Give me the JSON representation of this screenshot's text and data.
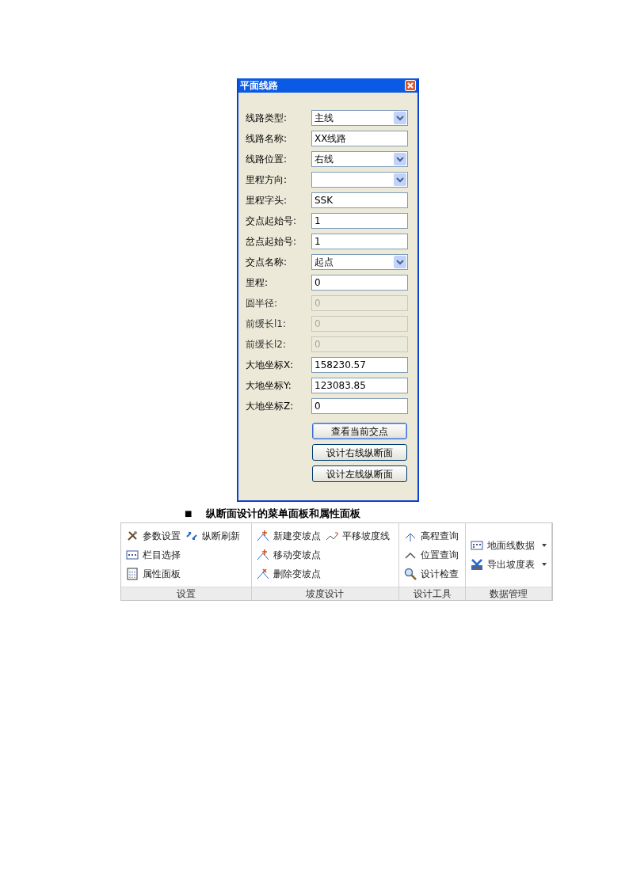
{
  "dialog": {
    "title": "平面线路",
    "fields": [
      {
        "label": "线路类型:",
        "kind": "select",
        "value": "主线",
        "disabled": false
      },
      {
        "label": "线路名称:",
        "kind": "text",
        "value": "XX线路",
        "disabled": false
      },
      {
        "label": "线路位置:",
        "kind": "select",
        "value": "右线",
        "disabled": false
      },
      {
        "label": "里程方向:",
        "kind": "select",
        "disabled": false
      },
      {
        "label": "里程字头:",
        "kind": "text",
        "value": "SSK",
        "disabled": false
      },
      {
        "label": "交点起始号:",
        "kind": "text",
        "value": "1",
        "disabled": false
      },
      {
        "label": "岔点起始号:",
        "kind": "text",
        "value": "1",
        "disabled": false
      },
      {
        "label": "交点名称:",
        "kind": "select",
        "value": "起点",
        "disabled": false
      },
      {
        "label": "里程:",
        "kind": "text",
        "value": "0",
        "disabled": false
      },
      {
        "label": "圆半径:",
        "kind": "text",
        "value": "0",
        "disabled": true
      },
      {
        "label": "前缓长l1:",
        "kind": "text",
        "value": "0",
        "disabled": true
      },
      {
        "label": "前缓长l2:",
        "kind": "text",
        "value": "0",
        "disabled": true
      },
      {
        "label": "大地坐标X:",
        "kind": "text",
        "value": "158230.57",
        "disabled": false
      },
      {
        "label": "大地坐标Y:",
        "kind": "text",
        "value": "123083.85",
        "disabled": false
      },
      {
        "label": "大地坐标Z:",
        "kind": "text",
        "value": "0",
        "disabled": false
      }
    ],
    "buttons": [
      {
        "label": "查看当前交点",
        "focused": true
      },
      {
        "label": "设计右线纵断面",
        "focused": false
      },
      {
        "label": "设计左线纵断面",
        "focused": false
      }
    ]
  },
  "caption": {
    "bullet": "■",
    "text": "纵断面设计的菜单面板和属性面板"
  },
  "ribbon": {
    "groups": [
      {
        "label": "设置",
        "columns": [
          [
            {
              "label": "参数设置"
            },
            {
              "label": "栏目选择"
            },
            {
              "label": "属性面板"
            }
          ],
          [
            {
              "label": "纵断刷新"
            }
          ]
        ]
      },
      {
        "label": "坡度设计",
        "columns": [
          [
            {
              "label": "新建变坡点"
            },
            {
              "label": "移动变坡点"
            },
            {
              "label": "删除变坡点"
            }
          ],
          [
            {
              "label": "平移坡度线"
            }
          ]
        ]
      },
      {
        "label": "设计工具",
        "columns": [
          [
            {
              "label": "高程查询"
            },
            {
              "label": "位置查询"
            },
            {
              "label": "设计检查"
            }
          ]
        ]
      },
      {
        "label": "数据管理",
        "columns": [
          [
            {
              "label": "地面线数据",
              "dropdown": true
            },
            {
              "label": "导出坡度表",
              "dropdown": true
            }
          ]
        ]
      }
    ]
  }
}
